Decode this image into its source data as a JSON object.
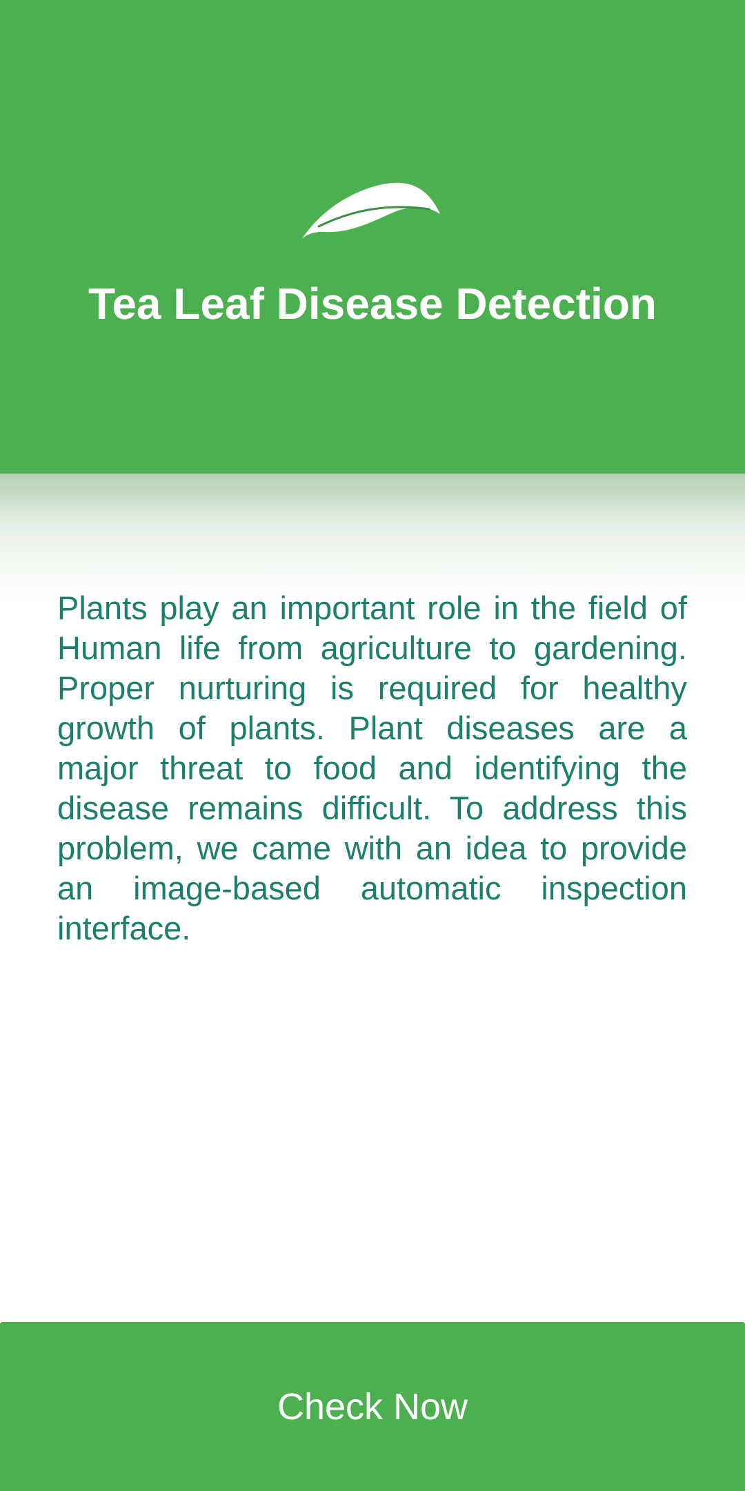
{
  "header": {
    "logo_icon": "leaf-icon",
    "title": "Tea Leaf Disease Detection",
    "background_color": "#4caf50"
  },
  "main": {
    "description": "Plants play an important role in the field of Human life from agriculture to gardening. Proper nurturing is required for healthy growth of plants. Plant diseases are a major threat to food and identifying the disease remains difficult. To address this problem, we came with an idea to provide an image-based automatic inspection interface.",
    "text_color": "#1b7f6b"
  },
  "footer": {
    "button_label": "Check Now",
    "button_color": "#4caf50"
  }
}
